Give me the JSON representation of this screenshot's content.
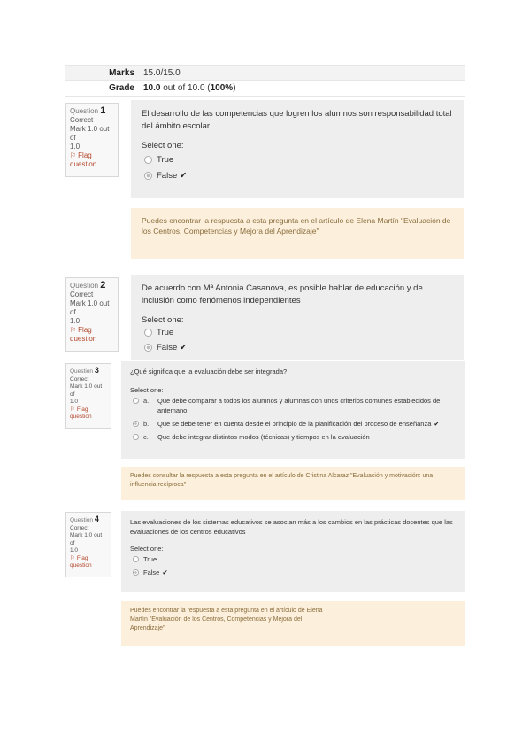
{
  "summary": {
    "marks_label": "Marks",
    "marks_value": "15.0/15.0",
    "grade_label": "Grade",
    "grade_value_strong": "10.0",
    "grade_value_mid": " out of 10.0 (",
    "grade_value_pct": "100%",
    "grade_value_end": ")"
  },
  "questions": [
    {
      "label": "Question",
      "number": "1",
      "state": "Correct",
      "mark_line1": "Mark 1.0 out of",
      "mark_line2": "1.0",
      "flag_line1": "Flag",
      "flag_line2": "question",
      "text": "El desarrollo de las competencias que logren los alumnos son responsabilidad total del ámbito escolar",
      "prompt": "Select one:",
      "options": [
        "True",
        "False"
      ],
      "feedback": "Puedes encontrar la respuesta a esta pregunta en el artículo de Elena Martín \"Evaluación de los Centros, Competencias y Mejora del Aprendizaje\""
    },
    {
      "label": "Question",
      "number": "2",
      "state": "Correct",
      "mark_line1": "Mark 1.0 out of",
      "mark_line2": "1.0",
      "flag_line1": "Flag",
      "flag_line2": "question",
      "text": "De acuerdo con Mª Antonia Casanova, es posible hablar de educación y de inclusión como fenómenos independientes",
      "prompt": "Select one:",
      "options": [
        "True",
        "False"
      ]
    },
    {
      "label": "Question",
      "number": "3",
      "state": "Correct",
      "mark_line1": "Mark 1.0 out of",
      "mark_line2": "1.0",
      "flag_line1": "Flag",
      "flag_line2": "question",
      "text": "¿Qué significa que la evaluación debe ser integrada?",
      "prompt": "Select one:",
      "options": [
        {
          "letter": "a.",
          "text": "Que debe comparar a todos los alumnos y alumnas con unos criterios comunes establecidos de antemano"
        },
        {
          "letter": "b.",
          "text": "Que se debe tener en cuenta desde el principio de la planificación del proceso de enseñanza"
        },
        {
          "letter": "c.",
          "text": "Que debe integrar distintos modos (técnicas) y tiempos en la evaluación"
        }
      ],
      "feedback": "Puedes consultar la respuesta a esta pregunta en el artículo de Cristina Alcaraz \"Evaluación y motivación: una influencia recíproca\""
    },
    {
      "label": "Question",
      "number": "4",
      "state": "Correct",
      "mark_line1": "Mark 1.0 out of",
      "mark_line2": "1.0",
      "flag_line1": "Flag",
      "flag_line2": "question",
      "text": "Las evaluaciones de los sistemas educativos se asocian más a los cambios en las prácticas docentes que las evaluaciones de los centros educativos",
      "prompt": "Select one:",
      "options": [
        "True",
        "False"
      ],
      "feedback_lines": [
        "Puedes encontrar la respuesta a esta pregunta en el artículo de Elena",
        "Martín \"Evaluación de los Centros, Competencias y Mejora del",
        "Aprendizaje\""
      ]
    }
  ],
  "icons": {
    "flag": "flag-icon",
    "check": "checkmark-icon"
  },
  "colors": {
    "feedback_bg": "#fcefdc",
    "feedback_text": "#8a6d3b",
    "flag": "#b3452a",
    "content_bg": "#eeeeee"
  }
}
